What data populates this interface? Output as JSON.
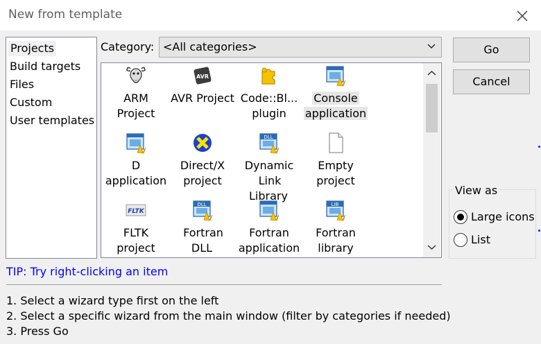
{
  "window": {
    "title": "New from template"
  },
  "categories_list": [
    {
      "label": "Projects",
      "selected": true
    },
    {
      "label": "Build targets",
      "selected": false
    },
    {
      "label": "Files",
      "selected": false
    },
    {
      "label": "Custom",
      "selected": false
    },
    {
      "label": "User templates",
      "selected": false
    }
  ],
  "category_filter": {
    "label": "Category:",
    "value": "<All categories>"
  },
  "templates": [
    {
      "line1": "ARM",
      "line2": "Project",
      "icon": "gnu-icon",
      "selected": false
    },
    {
      "line1": "AVR Project",
      "line2": "",
      "icon": "avr-chip-icon",
      "selected": false
    },
    {
      "line1": "Code::Bl...",
      "line2": "plugin",
      "icon": "puzzle-icon",
      "selected": false
    },
    {
      "line1": "Console",
      "line2": "application",
      "icon": "app-window-icon",
      "selected": true
    },
    {
      "line1": "D",
      "line2": "application",
      "icon": "app-window-icon",
      "selected": false
    },
    {
      "line1": "Direct/X",
      "line2": "project",
      "icon": "directx-icon",
      "selected": false
    },
    {
      "line1": "Dynamic",
      "line2": "Link Library",
      "icon": "dll-icon",
      "selected": false
    },
    {
      "line1": "Empty",
      "line2": "project",
      "icon": "blank-file-icon",
      "selected": false
    },
    {
      "line1": "FLTK",
      "line2": "project",
      "icon": "fltk-icon",
      "selected": false
    },
    {
      "line1": "Fortran DLL",
      "line2": "",
      "icon": "dll-icon",
      "selected": false
    },
    {
      "line1": "Fortran",
      "line2": "application",
      "icon": "app-window-icon",
      "selected": false
    },
    {
      "line1": "Fortran",
      "line2": "library",
      "icon": "lib-icon",
      "selected": false
    }
  ],
  "tip": "TIP: Try right-clicking an item",
  "instructions": [
    "1. Select a wizard type first on the left",
    "2. Select a specific wizard from the main window (filter by categories if needed)",
    "3. Press Go"
  ],
  "buttons": {
    "go": "Go",
    "cancel": "Cancel"
  },
  "view_as": {
    "legend": "View as",
    "options": [
      {
        "label": "Large icons",
        "selected": true
      },
      {
        "label": "List",
        "selected": false
      }
    ]
  },
  "icon_text": {
    "avr": "AVR",
    "dll": "DLL",
    "lib": "LIB",
    "fltk": "FLTK"
  },
  "colors": {
    "tip": "#0000ff",
    "window_bg": "#f0f0f0",
    "selection": "#e6e6e6"
  }
}
